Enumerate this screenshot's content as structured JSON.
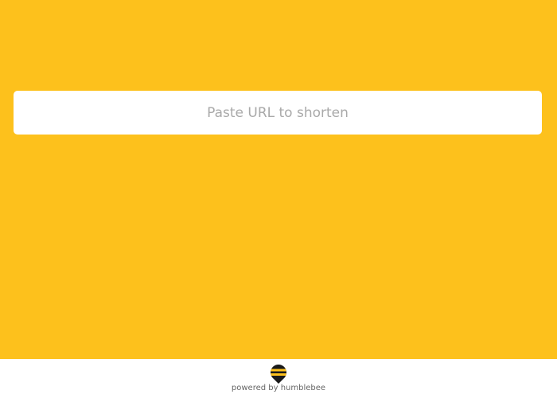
{
  "url_form": {
    "placeholder": "Paste URL to shorten",
    "value": ""
  },
  "footer": {
    "logo_icon": "bee-icon",
    "powered_by_text": "powered by humblebee"
  },
  "colors": {
    "background": "#FDC11C",
    "input_background": "#FFFFFF",
    "footer_background": "#FFFFFF",
    "logo_black": "#1A1A1A",
    "logo_yellow": "#FDC11C"
  }
}
